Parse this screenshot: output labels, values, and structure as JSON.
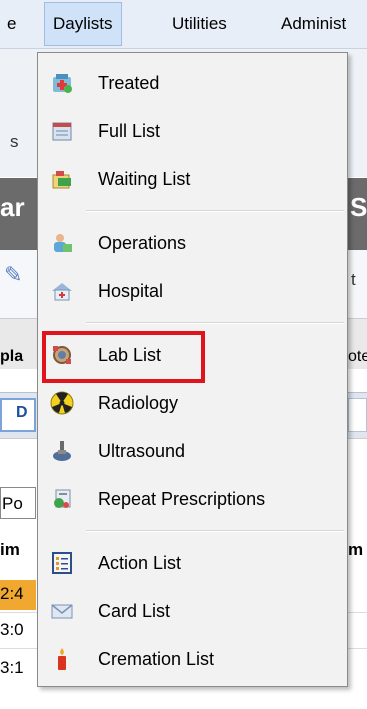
{
  "menubar": {
    "partial_left": "e",
    "daylists": "Daylists",
    "utilities": "Utilities",
    "administration_partial": "Administ"
  },
  "background": {
    "s_text": "s",
    "ar_text": "ar",
    "si_text": "Si",
    "t_text": "t",
    "pla_text": "pla",
    "ote_text": "ote",
    "d_text": "D",
    "po_text": "Po",
    "im_text": "im",
    "m_text": "m",
    "time1": "2:4",
    "time2": "3:0",
    "time3": "3:1"
  },
  "menu": {
    "items": [
      {
        "label": "Treated",
        "icon": "treated-icon"
      },
      {
        "label": "Full List",
        "icon": "full-list-icon"
      },
      {
        "label": "Waiting List",
        "icon": "waiting-list-icon"
      },
      {
        "label": "Operations",
        "icon": "operations-icon"
      },
      {
        "label": "Hospital",
        "icon": "hospital-icon"
      },
      {
        "label": "Lab List",
        "icon": "lab-list-icon"
      },
      {
        "label": "Radiology",
        "icon": "radiology-icon"
      },
      {
        "label": "Ultrasound",
        "icon": "ultrasound-icon"
      },
      {
        "label": "Repeat Prescriptions",
        "icon": "repeat-prescriptions-icon"
      },
      {
        "label": "Action List",
        "icon": "action-list-icon"
      },
      {
        "label": "Card List",
        "icon": "card-list-icon"
      },
      {
        "label": "Cremation List",
        "icon": "cremation-list-icon"
      }
    ]
  },
  "colors": {
    "highlight": "#e0141c",
    "menu_bg": "#f2f2f2",
    "active_tab": "#cfe2f8"
  }
}
